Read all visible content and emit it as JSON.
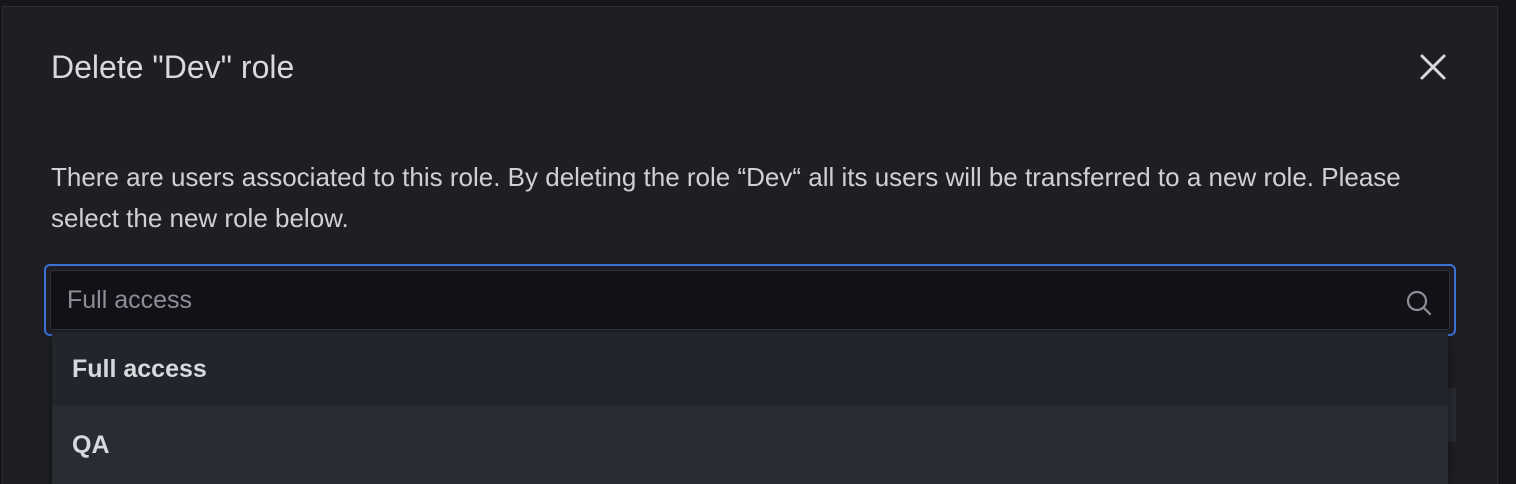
{
  "modal": {
    "title": "Delete \"Dev\" role",
    "close_icon": "close-icon",
    "description": "There are users associated to this role. By deleting the role “Dev“ all its users will be transferred to a new role. Please select the new role below."
  },
  "role_select": {
    "placeholder": "Full access",
    "value": "",
    "search_icon": "search-icon",
    "accent_color": "#3d71d9"
  },
  "dropdown": {
    "options": [
      {
        "label": "Full access"
      },
      {
        "label": "QA"
      }
    ]
  }
}
